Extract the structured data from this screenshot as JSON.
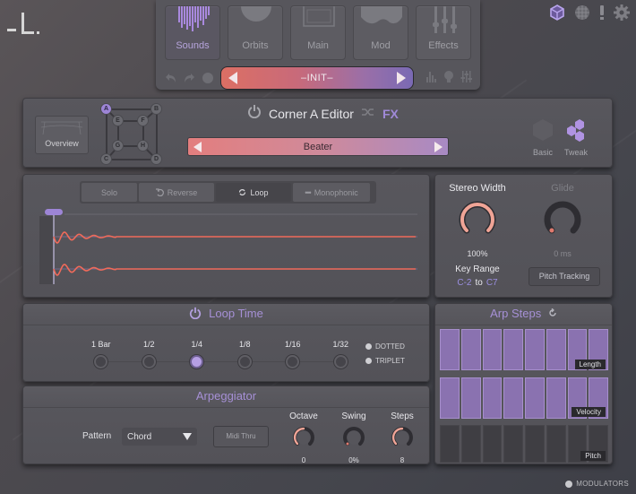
{
  "app": {
    "logo": "L"
  },
  "top_icons": [
    {
      "name": "cube-icon",
      "color": "#a48ee0"
    },
    {
      "name": "globe-icon",
      "color": "#8a8a90"
    },
    {
      "name": "alert-icon",
      "color": "#8a8a90"
    },
    {
      "name": "gear-icon",
      "color": "#8a8a90"
    }
  ],
  "nav": {
    "tabs": [
      {
        "label": "Sounds",
        "icon": "sounds-bars-icon",
        "active": true
      },
      {
        "label": "Orbits",
        "icon": "orbits-icon",
        "active": false
      },
      {
        "label": "Main",
        "icon": "main-icon",
        "active": false
      },
      {
        "label": "Mod",
        "icon": "mod-wave-icon",
        "active": false
      },
      {
        "label": "Effects",
        "icon": "sliders-icon",
        "active": false
      }
    ],
    "left_icons": [
      "undo-icon",
      "redo-icon",
      "chat-icon"
    ],
    "right_icons": [
      "histogram-icon",
      "head-icon",
      "mixer-icon"
    ],
    "preset": {
      "name": "–INIT–",
      "prev_icon": "triangle-left-icon",
      "next_icon": "triangle-right-icon"
    }
  },
  "corner_editor": {
    "overview_label": "Overview",
    "title": "Corner A Editor",
    "fx_label": "FX",
    "nodes": [
      "A",
      "B",
      "C",
      "D",
      "E",
      "F",
      "G",
      "H"
    ],
    "selected_node": "A",
    "sound": "Beater",
    "modes": [
      {
        "label": "Basic",
        "active": false
      },
      {
        "label": "Tweak",
        "active": true
      }
    ],
    "accent": "#9d85d6"
  },
  "sample": {
    "toggles": [
      {
        "label": "Solo",
        "icon": "",
        "active": false
      },
      {
        "label": "Reverse",
        "icon": "reverse-icon",
        "active": false
      },
      {
        "label": "Loop",
        "icon": "loop-icon",
        "active": true
      },
      {
        "label": "Monophonic",
        "icon": "dots-icon",
        "active": false
      }
    ],
    "waveform_color": "#f06a5a"
  },
  "stereo": {
    "stereo_width": {
      "label": "Stereo Width",
      "value": "100%",
      "fraction": 1.0
    },
    "glide": {
      "label": "Glide",
      "value": "0 ms",
      "fraction": 0.0
    },
    "key_range": {
      "label": "Key Range",
      "low": "C-2",
      "to": "to",
      "high": "C7"
    },
    "pitch_tracking_label": "Pitch Tracking"
  },
  "loop_time": {
    "title": "Loop Time",
    "options": [
      "1 Bar",
      "1/2",
      "1/4",
      "1/8",
      "1/16",
      "1/32"
    ],
    "selected": "1/4",
    "modifiers": [
      "DOTTED",
      "TRIPLET"
    ]
  },
  "arpeggiator": {
    "title": "Arpeggiator",
    "pattern_label": "Pattern",
    "pattern_value": "Chord",
    "midi_thru_label": "Midi Thru",
    "knobs": [
      {
        "label": "Octave",
        "value": "0",
        "fraction": 0.5
      },
      {
        "label": "Swing",
        "value": "0%",
        "fraction": 0.0
      },
      {
        "label": "Steps",
        "value": "8",
        "fraction": 0.5
      }
    ]
  },
  "arp_steps": {
    "title": "Arp Steps",
    "rows": [
      {
        "label": "Length",
        "values": [
          1,
          1,
          1,
          1,
          1,
          1,
          1,
          1
        ]
      },
      {
        "label": "Velocity",
        "values": [
          1,
          1,
          1,
          1,
          1,
          1,
          1,
          1
        ]
      },
      {
        "label": "Pitch",
        "values": [
          0,
          0,
          0,
          0,
          0,
          0,
          0,
          0
        ]
      }
    ]
  },
  "footer": {
    "modulators_label": "MODULATORS"
  }
}
